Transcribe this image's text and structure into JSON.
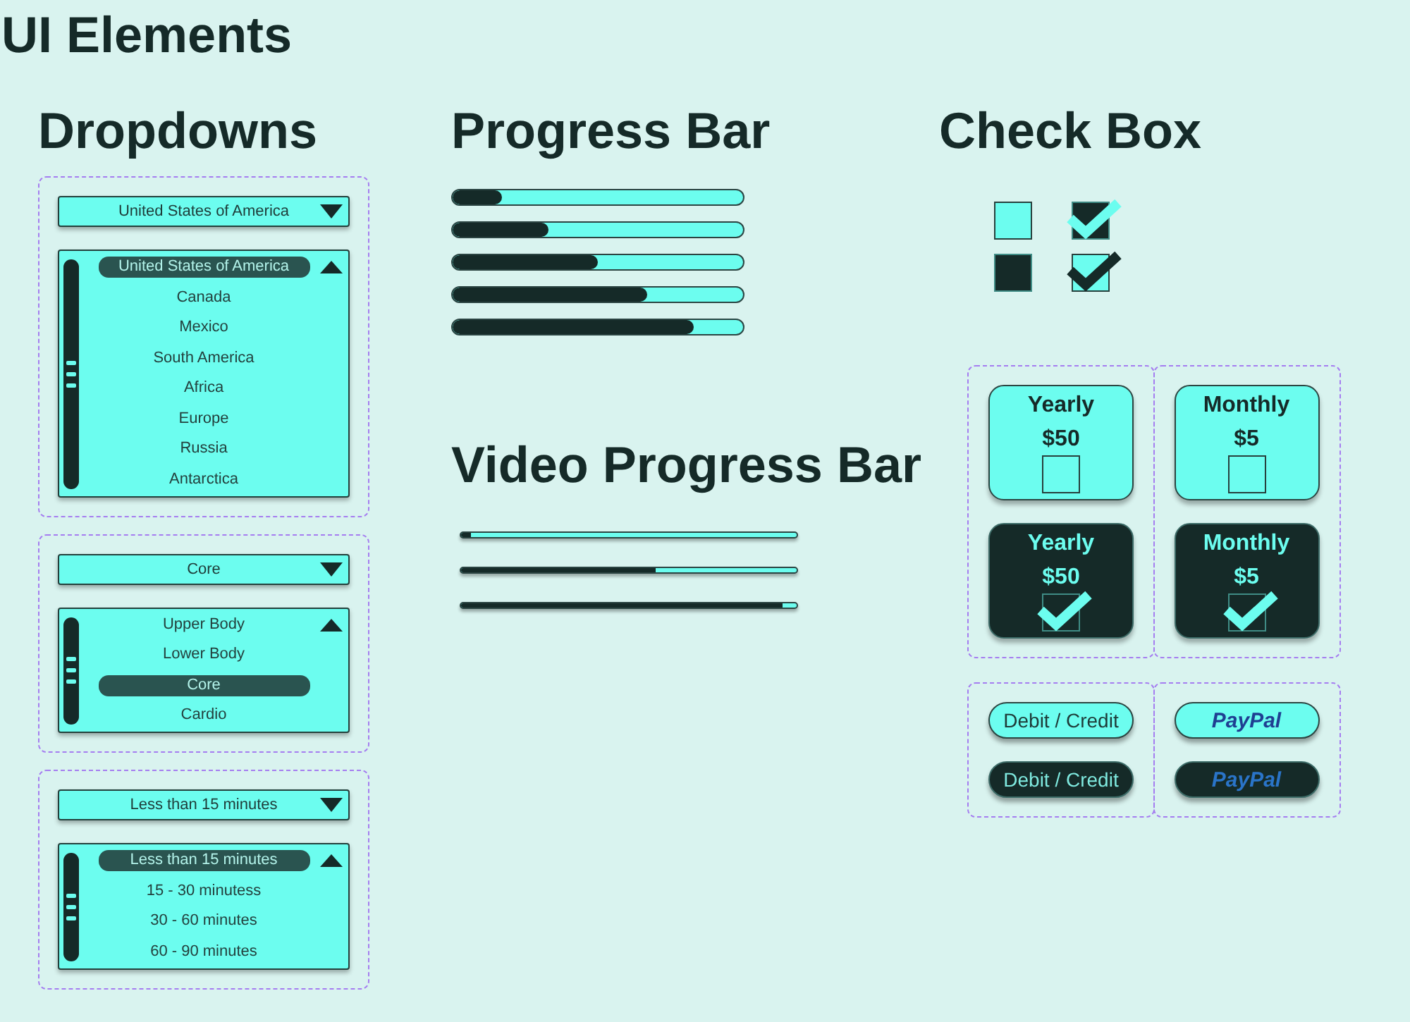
{
  "title": "UI Elements",
  "dropdowns": {
    "heading": "Dropdowns",
    "groups": [
      {
        "value": "United States of America",
        "options": [
          {
            "label": "United States of America",
            "selected": true
          },
          {
            "label": "Canada",
            "selected": false
          },
          {
            "label": "Mexico",
            "selected": false
          },
          {
            "label": "South America",
            "selected": false
          },
          {
            "label": "Africa",
            "selected": false
          },
          {
            "label": "Europe",
            "selected": false
          },
          {
            "label": "Russia",
            "selected": false
          },
          {
            "label": "Antarctica",
            "selected": false
          }
        ]
      },
      {
        "value": "Core",
        "options": [
          {
            "label": "Upper Body",
            "selected": false
          },
          {
            "label": "Lower Body",
            "selected": false
          },
          {
            "label": "Core",
            "selected": true
          },
          {
            "label": "Cardio",
            "selected": false
          }
        ]
      },
      {
        "value": "Less than 15 minutes",
        "options": [
          {
            "label": "Less than 15 minutes",
            "selected": true
          },
          {
            "label": "15 - 30 minutess",
            "selected": false
          },
          {
            "label": "30 - 60 minutes",
            "selected": false
          },
          {
            "label": "60 - 90 minutes",
            "selected": false
          }
        ]
      }
    ]
  },
  "progress_bars": {
    "heading": "Progress Bar",
    "bars": [
      {
        "level": 0.17
      },
      {
        "level": 0.33
      },
      {
        "level": 0.5
      },
      {
        "level": 0.67
      },
      {
        "level": 0.83
      }
    ]
  },
  "video_progress_bars": {
    "heading": "Video Progress Bar",
    "bars": [
      {
        "level": 0.03
      },
      {
        "level": 0.58
      },
      {
        "level": 0.96
      }
    ]
  },
  "check_boxes": {
    "heading": "Check Box",
    "boxes": [
      {
        "kind": "light",
        "checked": false
      },
      {
        "kind": "dark",
        "checked": true
      },
      {
        "kind": "dark",
        "checked": false
      },
      {
        "kind": "light",
        "checked": true
      }
    ]
  },
  "plan_groups": [
    {
      "cards": [
        {
          "label": "Yearly",
          "price": "$50",
          "selected": false,
          "checked": false
        },
        {
          "label": "Yearly",
          "price": "$50",
          "selected": true,
          "checked": true
        }
      ]
    },
    {
      "cards": [
        {
          "label": "Monthly",
          "price": "$5",
          "selected": false,
          "checked": false
        },
        {
          "label": "Monthly",
          "price": "$5",
          "selected": true,
          "checked": true
        }
      ]
    }
  ],
  "payment_groups": [
    {
      "buttons": [
        {
          "kind": "text",
          "label": "Debit / Credit",
          "selected": false
        },
        {
          "kind": "text",
          "label": "Debit / Credit",
          "selected": true
        }
      ]
    },
    {
      "buttons": [
        {
          "kind": "logo",
          "label": "PayPal",
          "selected": false
        },
        {
          "kind": "logo",
          "label": "PayPal",
          "selected": true
        }
      ]
    }
  ]
}
